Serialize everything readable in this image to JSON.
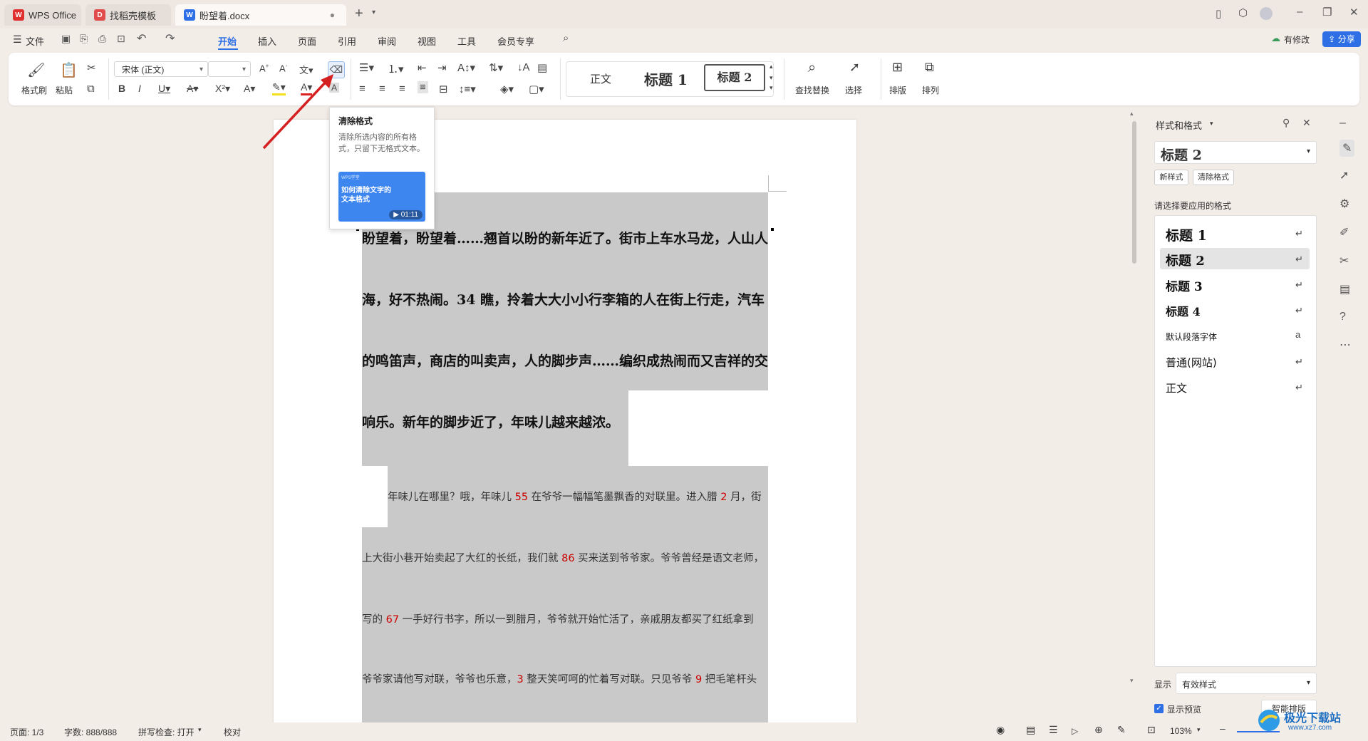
{
  "titlebar": {
    "tabs": [
      {
        "label": "WPS Office"
      },
      {
        "label": "找稻壳模板"
      },
      {
        "label": "盼望着.docx"
      }
    ]
  },
  "menu": {
    "file": "文件",
    "items": [
      "开始",
      "插入",
      "页面",
      "引用",
      "审阅",
      "视图",
      "工具",
      "会员专享"
    ],
    "active": "开始",
    "modified": "有修改",
    "share": "分享"
  },
  "ribbon": {
    "format_painter": "格式刷",
    "paste": "粘贴",
    "font_name": "宋体 (正文)",
    "font_size": "",
    "style_normal": "正文",
    "style_h1": "标题 1",
    "style_h2": "标题 2",
    "find_replace": "查找替换",
    "select": "选择",
    "layout": "排版",
    "arrange": "排列"
  },
  "tooltip": {
    "title": "清除格式",
    "desc": "清除所选内容的所有格式，只留下无格式文本。",
    "video_brand": "WPS学堂",
    "video_title": "如何清除文字的文本格式",
    "video_time": "01:11"
  },
  "document": {
    "bold_lines": [
      "盼望着，盼望着……翘首以盼的新年近了。街市上车水马龙，人山人",
      "海，好不热闹。34 瞧，拎着大大小小行李箱的人在街上行走，汽车",
      "的鸣笛声，商店的叫卖声，人的脚步声……编织成热闹而又吉祥的交",
      "响乐。新年的脚步近了，年味儿越来越浓。"
    ],
    "normal_lines": [
      {
        "a": "年味儿在哪里？哦，年味儿 ",
        "n": "55",
        "b": " 在爷爷一幅幅笔墨飘香的对联里。进入腊 ",
        "n2": "2",
        "c": " 月，街"
      },
      {
        "a": "上大街小巷开始卖起了大红的长纸，我们就 ",
        "n": "86",
        "b": " 买来送到爷爷家。爷爷曾经是语文老师，",
        "n2": "",
        "c": ""
      },
      {
        "a": "写的 ",
        "n": "67",
        "b": " 一手好行书字，所以一到腊月，爷爷就开始忙活了，亲戚朋友都买了红纸拿到",
        "n2": "",
        "c": ""
      },
      {
        "a": "爷爷家请他写对联，爷爷也乐意，",
        "n": "3",
        "b": " 整天笑呵呵的忙着写对联。只见爷爷 ",
        "n2": "9",
        "c": " 把毛笔杆头"
      }
    ]
  },
  "panel": {
    "title": "样式和格式",
    "current_style": "标题 2",
    "new_style": "新样式",
    "clear_format": "清除格式",
    "prompt": "请选择要应用的格式",
    "styles": [
      "标题 1",
      "标题 2",
      "标题 3",
      "标题 4",
      "默认段落字体",
      "普通(网站)",
      "正文"
    ],
    "show_label": "显示",
    "show_value": "有效样式",
    "preview_label": "显示预览",
    "smart_layout": "智能排版"
  },
  "status": {
    "page": "页面: 1/3",
    "words": "字数: 888/888",
    "spell": "拼写检查: 打开",
    "proof": "校对",
    "zoom": "103%"
  },
  "watermark": {
    "text": "极光下载站",
    "url": "www.xz7.com"
  },
  "colors": {
    "accent": "#2f6fe6",
    "selection": "#c9c9c9",
    "arrow": "#d42020",
    "red": "#cc0000"
  }
}
